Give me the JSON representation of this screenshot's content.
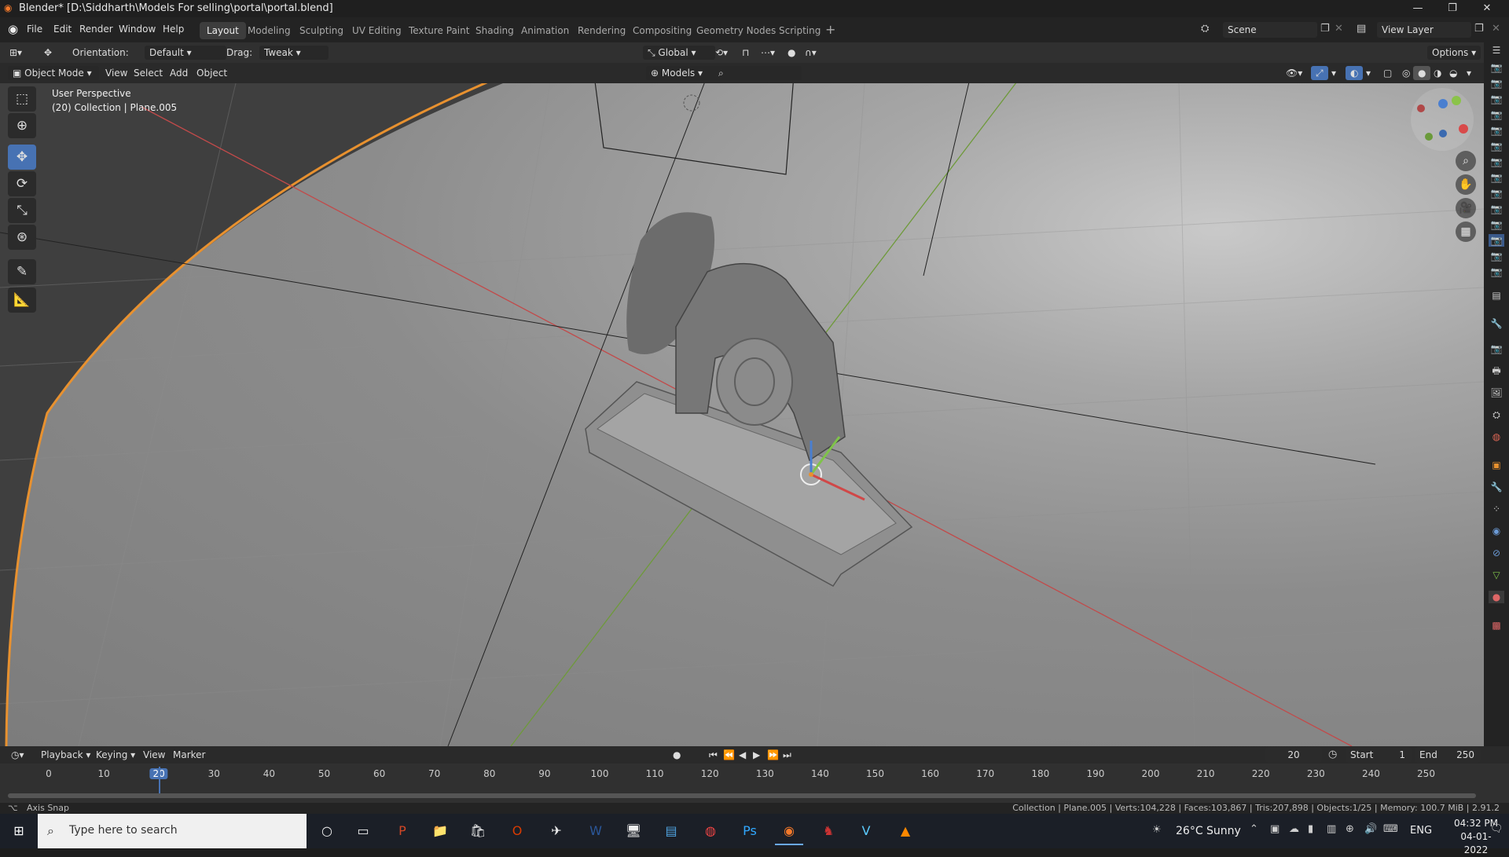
{
  "window": {
    "title": "Blender* [D:\\Siddharth\\Models For selling\\portal\\portal.blend]"
  },
  "menu": [
    "File",
    "Edit",
    "Render",
    "Window",
    "Help"
  ],
  "workspaces": [
    "Layout",
    "Modeling",
    "Sculpting",
    "UV Editing",
    "Texture Paint",
    "Shading",
    "Animation",
    "Rendering",
    "Compositing",
    "Geometry Nodes",
    "Scripting"
  ],
  "scene": {
    "name": "Scene",
    "view_layer": "View Layer"
  },
  "tool_header": {
    "orientation_label": "Orientation:",
    "orientation_value": "Default",
    "drag_label": "Drag:",
    "drag_value": "Tweak",
    "transform_space": "Global",
    "options": "Options"
  },
  "viewport_header": {
    "mode": "Object Mode",
    "view": "View",
    "select": "Select",
    "add": "Add",
    "object": "Object",
    "collection_filter": "Models"
  },
  "viewport": {
    "perspective": "User Perspective",
    "collection": "(20) Collection | Plane.005"
  },
  "timeline": {
    "menus": [
      "Playback",
      "Keying",
      "View",
      "Marker"
    ],
    "current_frame": "20",
    "start_label": "Start",
    "start": "1",
    "end_label": "End",
    "end": "250",
    "ticks": [
      "0",
      "10",
      "20",
      "30",
      "40",
      "50",
      "60",
      "70",
      "80",
      "90",
      "100",
      "110",
      "120",
      "130",
      "140",
      "150",
      "160",
      "170",
      "180",
      "190",
      "200",
      "210",
      "220",
      "230",
      "240",
      "250"
    ]
  },
  "status": {
    "left": "Axis Snap",
    "right": "Collection | Plane.005 | Verts:104,228 | Faces:103,867 | Tris:207,898 | Objects:1/25 | Memory: 100.7 MiB | 2.91.2"
  },
  "taskbar": {
    "search_placeholder": "Type here to search",
    "weather": "26°C  Sunny",
    "lang": "ENG",
    "time": "04:32 PM",
    "date": "04-01-2022"
  }
}
